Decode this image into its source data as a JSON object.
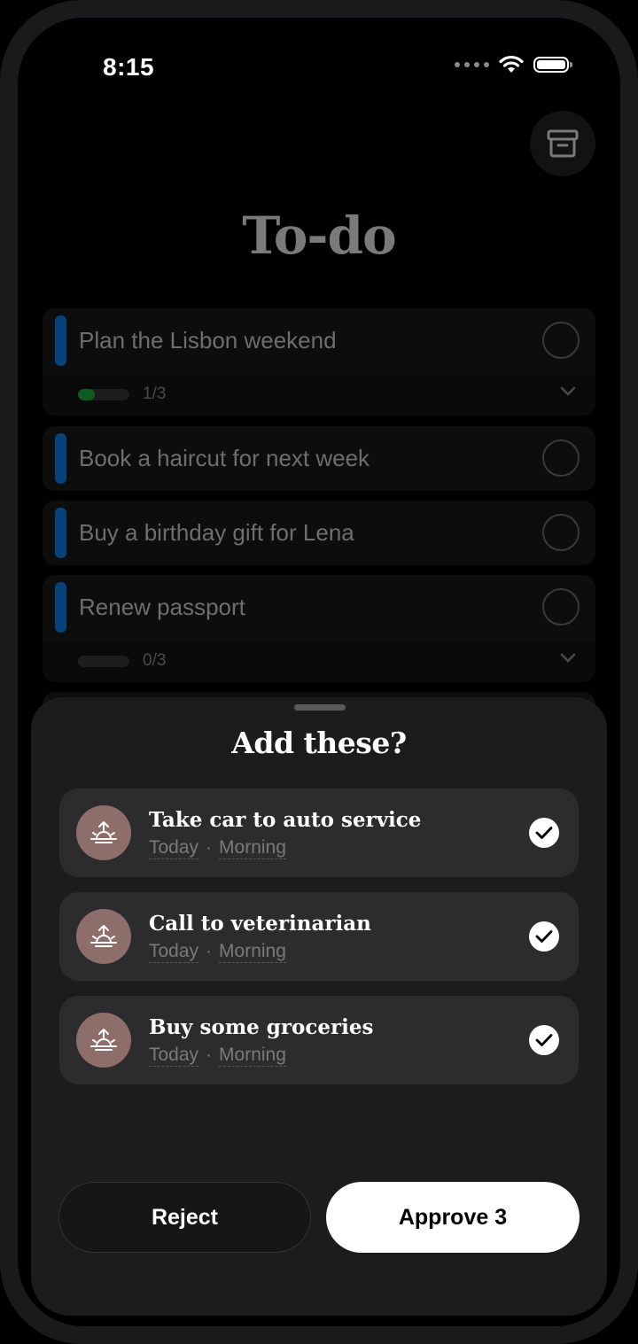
{
  "status_bar": {
    "time": "8:15"
  },
  "header": {
    "title": "To-do",
    "archive_icon": "archive-icon"
  },
  "tasks": [
    {
      "label": "Plan the Lisbon weekend",
      "progress_text": "1/3",
      "progress": 0.333,
      "color": "#06437a"
    },
    {
      "label": "Book a haircut for next week",
      "color": "#06437a"
    },
    {
      "label": "Buy a birthday gift for Lena",
      "color": "#06437a"
    },
    {
      "label": "Renew passport",
      "progress_text": "0/3",
      "progress": 0.0,
      "color": "#06437a"
    }
  ],
  "sheet": {
    "title": "Add these?",
    "suggestions": [
      {
        "title": "Take car to auto service",
        "day": "Today",
        "time": "Morning",
        "selected": true,
        "icon": "sunrise-icon"
      },
      {
        "title": "Call to veterinarian",
        "day": "Today",
        "time": "Morning",
        "selected": true,
        "icon": "sunrise-icon"
      },
      {
        "title": "Buy some groceries",
        "day": "Today",
        "time": "Morning",
        "selected": true,
        "icon": "sunrise-icon"
      }
    ],
    "separator": "·",
    "reject_label": "Reject",
    "approve_label": "Approve 3"
  },
  "colors": {
    "accent_bar": "#06437a",
    "progress_fill": "#0f5a1e",
    "avatar": "#8e6e6a"
  }
}
